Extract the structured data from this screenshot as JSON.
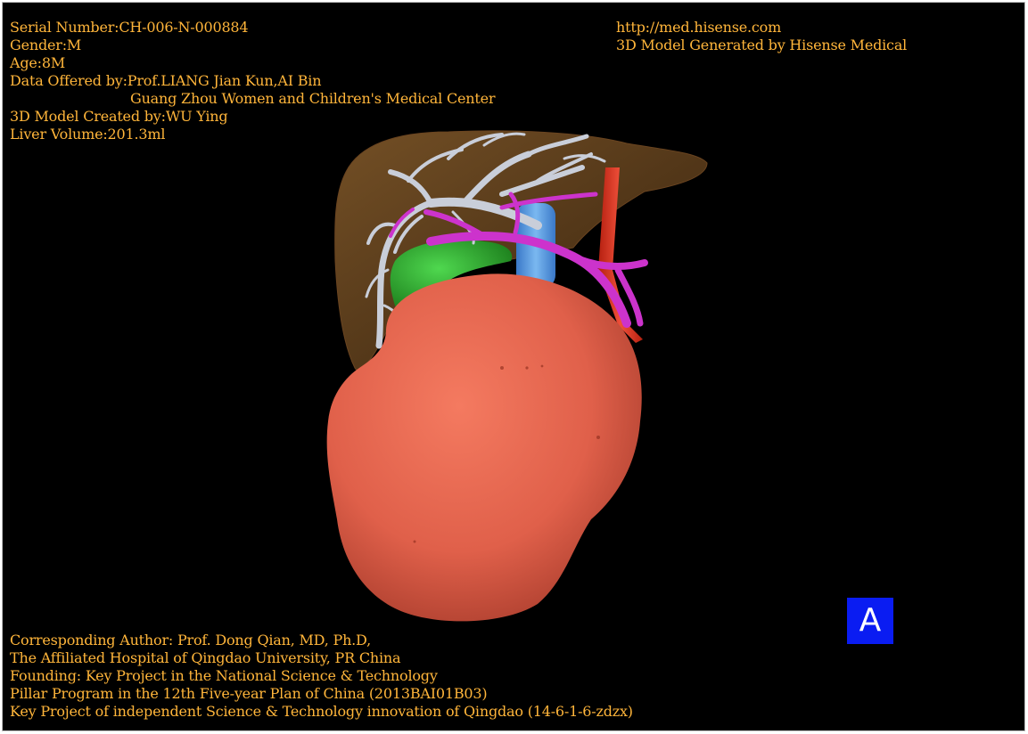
{
  "header_left": {
    "serial": "Serial Number:CH-006-N-000884",
    "gender": "Gender:M",
    "age": "Age:8M",
    "data_offered": "Data Offered by:Prof.LIANG Jian Kun,AI Bin",
    "center": "Guang Zhou Women and Children's Medical Center",
    "model_created": "3D Model Created by:WU Ying",
    "liver_volume": "Liver Volume:201.3ml"
  },
  "header_right": {
    "url": "http://med.hisense.com",
    "generated": "3D Model Generated by Hisense Medical"
  },
  "footer": {
    "author": "Corresponding Author: Prof. Dong Qian, MD, Ph.D,",
    "affiliation": "The Affiliated Hospital of Qingdao University, PR China",
    "founding": "Founding: Key Project in the National Science & Technology",
    "pillar": "Pillar Program in the 12th Five-year Plan of China (2013BAI01B03)",
    "key_project": "Key Project of independent Science & Technology innovation of Qingdao (14-6-1-6-zdzx)"
  },
  "view_label": "A",
  "colors": {
    "text": "#ffb53a",
    "background": "#000000",
    "liver": "#8a5a2a",
    "tumor": "#e8654c",
    "portal_vein": "#cc33cc",
    "hepatic_vein": "#c8cdd8",
    "ivc": "#5aa0e8",
    "artery": "#e23a2a",
    "gallbladder": "#2fb52f",
    "badge": "#0a1cf2"
  }
}
